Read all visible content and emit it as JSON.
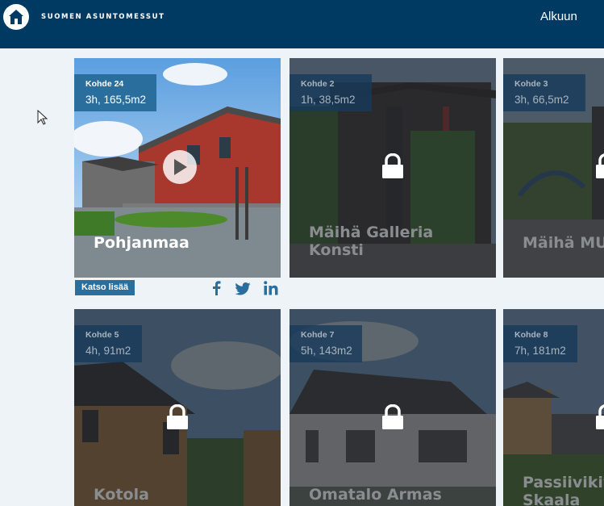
{
  "header": {
    "logo_text": "SUOMEN ASUNTOMESSUT",
    "home_link": "Alkuun"
  },
  "featured": {
    "more_label": "Katso lisää",
    "social_icons": [
      "facebook-icon",
      "twitter-icon",
      "linkedin-icon"
    ]
  },
  "cards": [
    {
      "number": "Kohde 24",
      "size": "3h, 165,5m2",
      "title_lines": [
        "Pohjanmaa"
      ],
      "locked": false
    },
    {
      "number": "Kohde 2",
      "size": "1h, 38,5m2",
      "title_lines": [
        "Mäihä Galleria",
        "Konsti"
      ],
      "locked": true
    },
    {
      "number": "Kohde 3",
      "size": "3h, 66,5m2",
      "title_lines": [
        "Mäihä MUU"
      ],
      "locked": true
    },
    {
      "number": "Kohde 5",
      "size": "4h, 91m2",
      "title_lines": [
        "Kotola"
      ],
      "locked": true
    },
    {
      "number": "Kohde 7",
      "size": "5h, 143m2",
      "title_lines": [
        "Omatalo Armas"
      ],
      "locked": true
    },
    {
      "number": "Kohde 8",
      "size": "7h, 181m2",
      "title_lines": [
        "Passiivikiv",
        "Skaala"
      ],
      "locked": true
    }
  ],
  "colors": {
    "header_bg": "#003a63",
    "badge_bg": "#2a6e9e",
    "page_bg": "#eef3f7"
  }
}
